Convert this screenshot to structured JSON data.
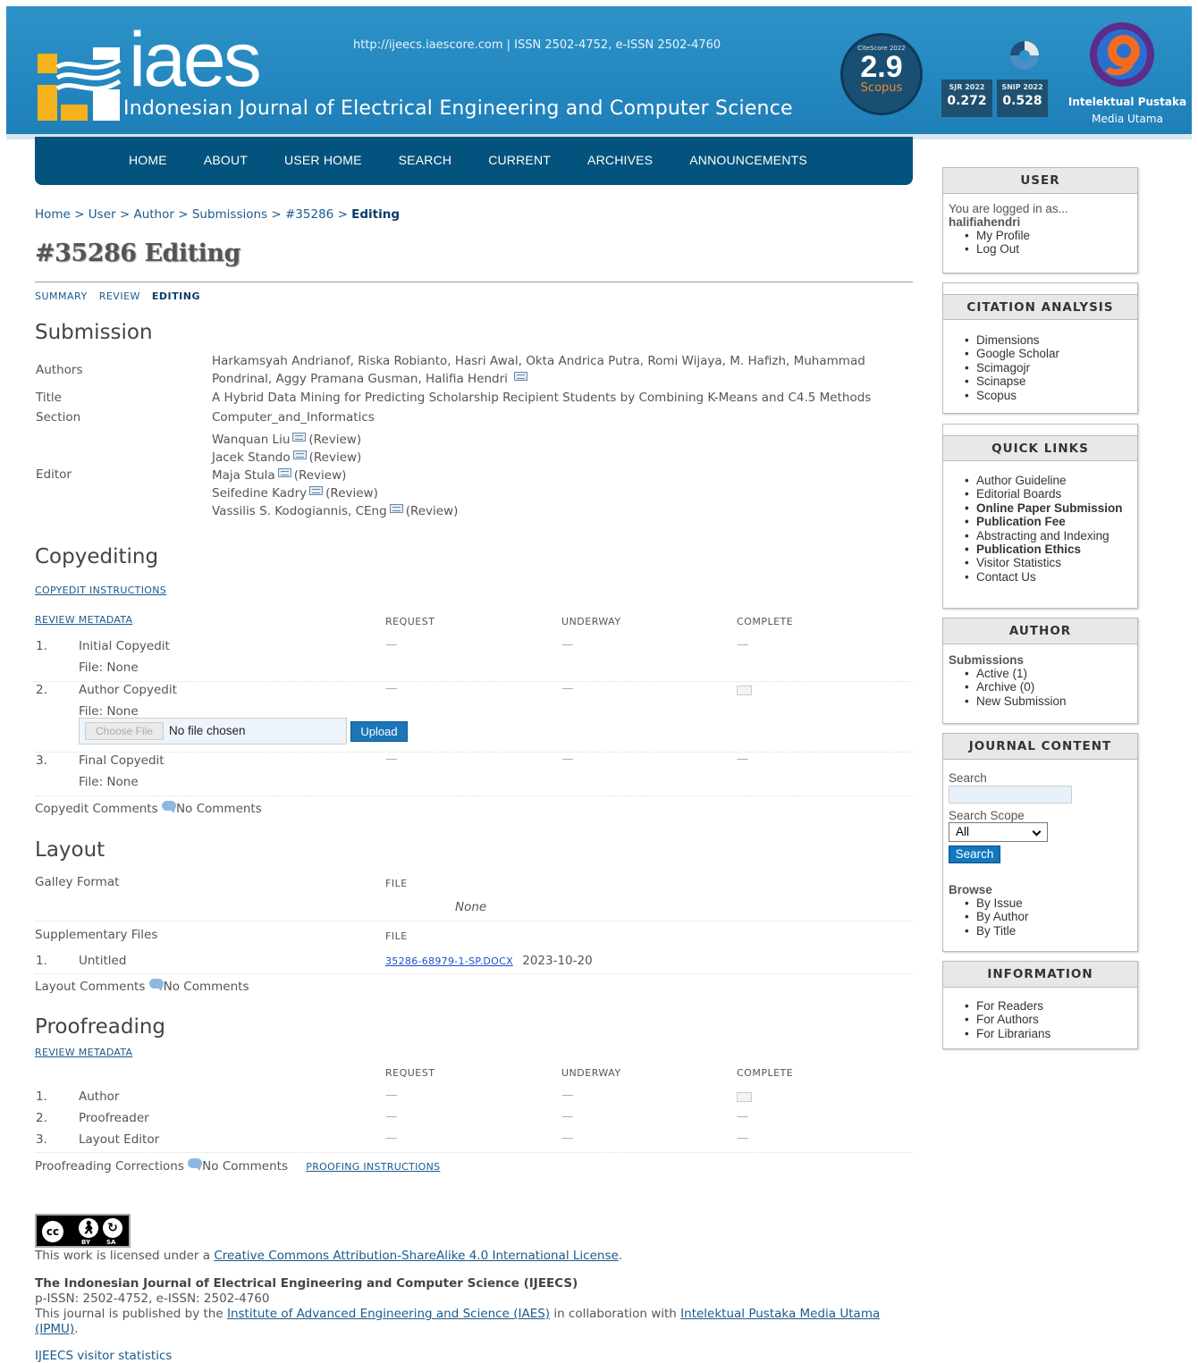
{
  "header": {
    "logo_text": "iaes",
    "journal_name": "Indonesian Journal of Electrical Engineering and Computer Science",
    "issn_line": "http://ijeecs.iaescore.com  |  ISSN 2502-4752, e-ISSN 2502-4760",
    "citescore": {
      "label": "CiteScore 2022",
      "value": "2.9",
      "source": "Scopus"
    },
    "sjr": {
      "label": "SJR 2022",
      "value": "0.272"
    },
    "snip": {
      "label": "SNIP 2022",
      "value": "0.528"
    },
    "publisher_name": "Intelektual Pustaka",
    "publisher_sub": "Media Utama"
  },
  "nav": {
    "items": [
      {
        "label": "HOME"
      },
      {
        "label": "ABOUT"
      },
      {
        "label": "USER HOME"
      },
      {
        "label": "SEARCH"
      },
      {
        "label": "CURRENT"
      },
      {
        "label": "ARCHIVES"
      },
      {
        "label": "ANNOUNCEMENTS"
      }
    ]
  },
  "breadcrumb": {
    "items": [
      "Home",
      "User",
      "Author",
      "Submissions",
      "#35286"
    ],
    "separator": ">",
    "current": "Editing"
  },
  "page_title": "#35286 Editing",
  "subnav": {
    "summary": "SUMMARY",
    "review": "REVIEW",
    "editing": "EDITING"
  },
  "submission": {
    "heading": "Submission",
    "authors_label": "Authors",
    "authors_line1": "Harkamsyah Andrianof, Riska Robianto, Hasri Awal, Okta Andrica Putra, Romi Wijaya, M. Hafizh, Muhammad",
    "authors_line2": "Pondrinal, Aggy Pramana Gusman, Halifia Hendri",
    "title_label": "Title",
    "title_value": "A Hybrid Data Mining for Predicting Scholarship Recipient Students by Combining K-Means and C4.5 Methods",
    "section_label": "Section",
    "section_value": "Computer_and_Informatics",
    "editor_label": "Editor",
    "editors": [
      {
        "name": "Wanquan Liu",
        "role": "(Review)"
      },
      {
        "name": "Jacek Stando",
        "role": "(Review)"
      },
      {
        "name": "Maja Stula",
        "role": "(Review)"
      },
      {
        "name": "Seifedine Kadry",
        "role": "(Review)"
      },
      {
        "name": "Vassilis S. Kodogiannis, CEng",
        "role": "(Review)"
      }
    ]
  },
  "copyediting": {
    "heading": "Copyediting",
    "instructions_link": "COPYEDIT INSTRUCTIONS",
    "review_metadata": "REVIEW METADATA",
    "col_request": "REQUEST",
    "col_underway": "UNDERWAY",
    "col_complete": "COMPLETE",
    "rows": [
      {
        "num": "1.",
        "label": "Initial Copyedit",
        "file": "File: None",
        "request": "—",
        "underway": "—",
        "complete": "—"
      },
      {
        "num": "2.",
        "label": "Author Copyedit",
        "file": "File: None",
        "request": "—",
        "underway": "—",
        "complete": ""
      },
      {
        "num": "3.",
        "label": "Final Copyedit",
        "file": "File: None",
        "request": "—",
        "underway": "—",
        "complete": "—"
      }
    ],
    "choose_file": "Choose File",
    "no_file": "No file chosen",
    "upload": "Upload",
    "comments_label": "Copyedit Comments",
    "comments_value": "No Comments"
  },
  "layout": {
    "heading": "Layout",
    "galley_label": "Galley Format",
    "file_col": "FILE",
    "galley_none": "None",
    "supp_label": "Supplementary Files",
    "supp_file_col": "FILE",
    "supp_num": "1.",
    "supp_title": "Untitled",
    "supp_file": "35286-68979-1-SP.DOCX",
    "supp_date": "2023-10-20",
    "comments_label": "Layout Comments",
    "comments_value": "No Comments"
  },
  "proofreading": {
    "heading": "Proofreading",
    "review_metadata": "REVIEW METADATA",
    "col_request": "REQUEST",
    "col_underway": "UNDERWAY",
    "col_complete": "COMPLETE",
    "rows": [
      {
        "num": "1.",
        "label": "Author",
        "request": "—",
        "underway": "—",
        "complete": ""
      },
      {
        "num": "2.",
        "label": "Proofreader",
        "request": "—",
        "underway": "—",
        "complete": "—"
      },
      {
        "num": "3.",
        "label": "Layout Editor",
        "request": "—",
        "underway": "—",
        "complete": "—"
      }
    ],
    "corrections_label": "Proofreading Corrections",
    "corrections_value": "No Comments",
    "instructions_link": "PROOFING INSTRUCTIONS"
  },
  "sidebar": {
    "user": {
      "title": "USER",
      "logged_in": "You are logged in as...",
      "username": "halifiahendri",
      "links": [
        "My Profile",
        "Log Out"
      ]
    },
    "citation": {
      "title": "CITATION ANALYSIS",
      "links": [
        "Dimensions",
        "Google Scholar",
        "Scimagojr",
        "Scinapse",
        "Scopus"
      ]
    },
    "quick_links": {
      "title": "QUICK LINKS",
      "links": [
        "Author Guideline",
        "Editorial Boards",
        "Online Paper Submission",
        "Publication Fee",
        "Abstracting and Indexing",
        "Publication Ethics",
        "Visitor Statistics",
        "Contact Us"
      ]
    },
    "author": {
      "title": "AUTHOR",
      "subtitle": "Submissions",
      "links": [
        "Active (1)",
        "Archive (0)",
        "New Submission"
      ]
    },
    "journal_content": {
      "title": "JOURNAL CONTENT",
      "search_label": "Search",
      "scope_label": "Search Scope",
      "scope_value": "All",
      "search_button": "Search",
      "browse_label": "Browse",
      "links": [
        "By Issue",
        "By Author",
        "By Title"
      ]
    },
    "information": {
      "title": "INFORMATION",
      "links": [
        "For Readers",
        "For Authors",
        "For Librarians"
      ]
    }
  },
  "footer": {
    "cc_by": "BY",
    "cc_sa": "SA",
    "license_prefix": "This work is licensed under a",
    "license_link": "Creative Commons Attribution-ShareAlike 4.0 International License",
    "license_suffix": ".",
    "journal_full": "The Indonesian Journal of Electrical Engineering and Computer Science (IJEECS)",
    "issn": "p-ISSN: 2502-4752, e-ISSN: 2502-4760",
    "published_prefix": "This journal is published by the",
    "iaes_link": "Institute of Advanced Engineering and Science (IAES)",
    "collab": "in collaboration with",
    "ipmu_link_1": "Intelektual Pustaka Media Utama",
    "ipmu_link_2": "(IPMU)",
    "ipmu_suffix": ".",
    "visitor_stats": "IJEECS visitor statistics"
  }
}
